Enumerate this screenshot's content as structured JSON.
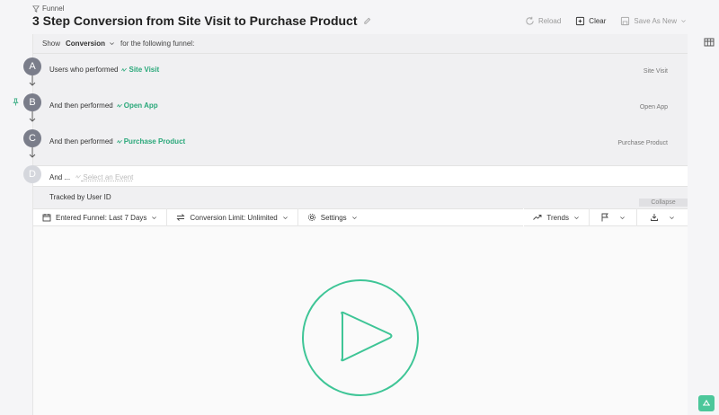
{
  "header": {
    "breadcrumb": "Funnel",
    "title": "3 Step Conversion from Site Visit to Purchase Product",
    "actions": {
      "reload": "Reload",
      "clear": "Clear",
      "save_as_new": "Save As New"
    }
  },
  "show_row": {
    "prefix": "Show",
    "metric": "Conversion",
    "suffix": "for the following funnel:"
  },
  "steps": [
    {
      "letter": "A",
      "label": "Users who performed",
      "event": "Site Visit",
      "right_label": "Site Visit"
    },
    {
      "letter": "B",
      "label": "And then performed",
      "event": "Open App",
      "right_label": "Open App"
    },
    {
      "letter": "C",
      "label": "And then performed",
      "event": "Purchase Product",
      "right_label": "Purchase Product"
    }
  ],
  "add_step": {
    "letter": "D",
    "label": "And ...",
    "placeholder": "Select an Event"
  },
  "tracked": {
    "label": "Tracked by User ID",
    "collapse": "Collapse"
  },
  "toolbar": {
    "entered_funnel": "Entered Funnel: Last 7 Days",
    "conversion_limit": "Conversion Limit: Unlimited",
    "settings": "Settings",
    "trends": "Trends"
  },
  "colors": {
    "accent": "#2aa87a",
    "play": "#3ec596",
    "badge": "#7a7d8a"
  }
}
